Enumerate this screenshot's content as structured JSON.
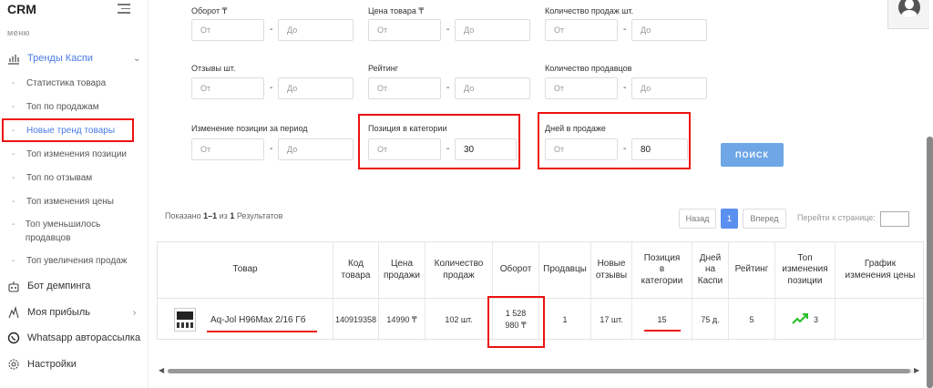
{
  "sidebar": {
    "logo": "CRM",
    "menu_label": "меню",
    "items": [
      {
        "label": "Тренды Каспи",
        "icon": "chart-icon"
      },
      {
        "label": "Бот демпинга",
        "icon": "robot-icon"
      },
      {
        "label": "Моя прибыль",
        "icon": "profit-icon"
      },
      {
        "label": "Whatsapp авторассылка",
        "icon": "whatsapp-icon"
      },
      {
        "label": "Настройки",
        "icon": "gear-icon"
      }
    ],
    "subitems": [
      {
        "label": "Статистика товара"
      },
      {
        "label": "Топ по продажам"
      },
      {
        "label": "Новые тренд товары"
      },
      {
        "label": "Топ изменения позиции"
      },
      {
        "label": "Топ по отзывам"
      },
      {
        "label": "Топ изменения цены"
      },
      {
        "label": "Топ уменьшилось продавцов"
      },
      {
        "label": "Топ увеличения продаж"
      }
    ]
  },
  "filters": {
    "from_placeholder": "От",
    "to_placeholder": "До",
    "groups": [
      {
        "label": "Оборот ₸"
      },
      {
        "label": "Цена товара ₸"
      },
      {
        "label": "Количество продаж шт."
      },
      {
        "label": "Отзывы шт."
      },
      {
        "label": "Рейтинг"
      },
      {
        "label": "Количество продавцов"
      },
      {
        "label": "Изменение позиции за период"
      },
      {
        "label": "Позиция в категории",
        "to_value": "30"
      },
      {
        "label": "Дней в продаже",
        "to_value": "80"
      }
    ],
    "dash": "-",
    "search_button": "ПОИСК"
  },
  "results": {
    "prefix": "Показано ",
    "range": "1–1",
    "middle": " из ",
    "count": "1",
    "suffix": " Результатов"
  },
  "pagination": {
    "prev": "Назад",
    "current": "1",
    "next": "Вперед",
    "goto_label": "Перейти к странице:"
  },
  "table": {
    "headers": [
      "Товар",
      "Код товара",
      "Цена продажи",
      "Количество продаж",
      "Оборот",
      "Продавцы",
      "Новые отзывы",
      "Позиция в категории",
      "Дней на Каспи",
      "Рейтинг",
      "Топ изменения позиции",
      "График изменения цены"
    ],
    "row": {
      "product": "Aq-Jol H96Max 2/16 Гб",
      "code": "140919358",
      "price": "14990 ₸",
      "sales": "102 шт.",
      "turnover": "1 528 980 ₸",
      "sellers": "1",
      "new_reviews": "17 шт.",
      "position": "15",
      "days": "75 д.",
      "rating": "5",
      "top_change": "3"
    }
  },
  "colors": {
    "accent": "#4a7be6",
    "highlight": "#e11111",
    "button": "#6ea6e6",
    "trend": "#2bbf2b"
  }
}
